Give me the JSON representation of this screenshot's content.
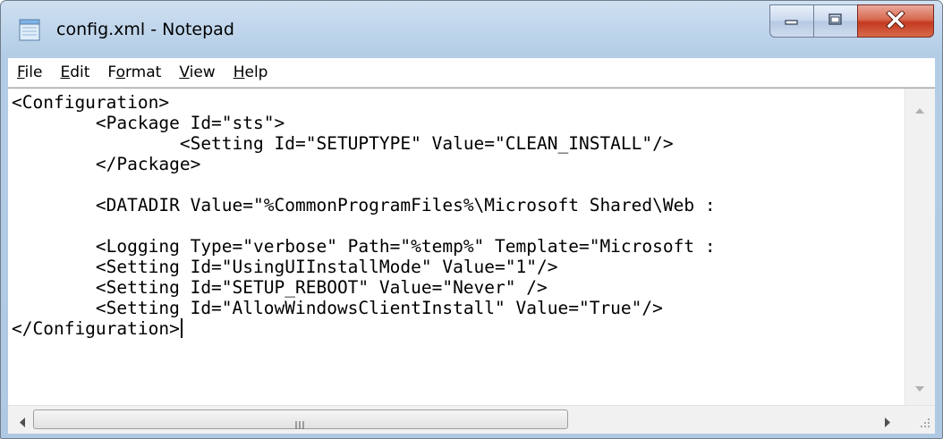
{
  "window": {
    "title": "config.xml - Notepad"
  },
  "menu": [
    {
      "pre": "",
      "key": "F",
      "post": "ile"
    },
    {
      "pre": "",
      "key": "E",
      "post": "dit"
    },
    {
      "pre": "F",
      "key": "o",
      "post": "rmat"
    },
    {
      "pre": "",
      "key": "V",
      "post": "iew"
    },
    {
      "pre": "",
      "key": "H",
      "post": "elp"
    }
  ],
  "editor": {
    "lines": [
      "<Configuration>",
      "        <Package Id=\"sts\">",
      "                <Setting Id=\"SETUPTYPE\" Value=\"CLEAN_INSTALL\"/>",
      "        </Package>",
      "",
      "        <DATADIR Value=\"%CommonProgramFiles%\\Microsoft Shared\\Web :",
      "",
      "        <Logging Type=\"verbose\" Path=\"%temp%\" Template=\"Microsoft :",
      "        <Setting Id=\"UsingUIInstallMode\" Value=\"1\"/>",
      "        <Setting Id=\"SETUP_REBOOT\" Value=\"Never\" />",
      "        <Setting Id=\"AllowWindowsClientInstall\" Value=\"True\"/>",
      "</Configuration>"
    ]
  },
  "icons": {
    "app": "notepad-icon",
    "minimize": "minimize-icon",
    "maximize": "maximize-icon",
    "close": "close-icon"
  },
  "colors": {
    "close_button": "#c4391f",
    "titlebar": "#bcd3ea"
  }
}
